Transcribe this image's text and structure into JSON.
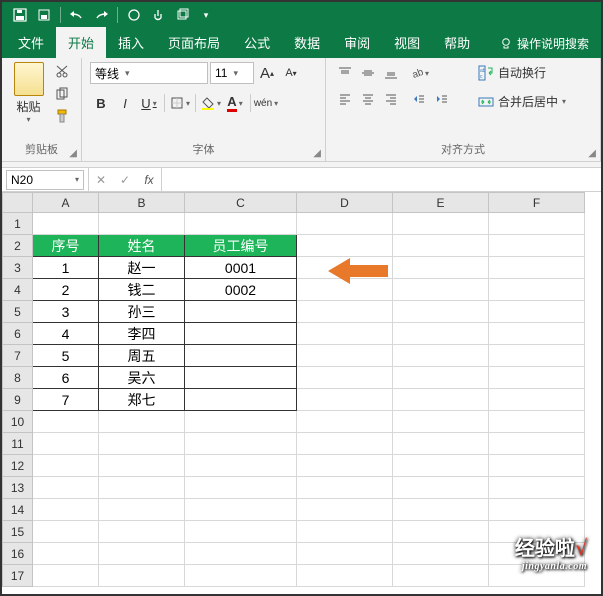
{
  "qat": {
    "dropdown": "▾"
  },
  "tabs": {
    "file": "文件",
    "home": "开始",
    "insert": "插入",
    "page_layout": "页面布局",
    "formulas": "公式",
    "data": "数据",
    "review": "审阅",
    "view": "视图",
    "help": "帮助",
    "tell_me": "操作说明搜索"
  },
  "ribbon": {
    "clipboard": {
      "paste": "粘贴",
      "label": "剪贴板"
    },
    "font": {
      "name": "等线",
      "size": "11",
      "bold": "B",
      "italic": "I",
      "underline": "U",
      "ruby": "wén",
      "label": "字体"
    },
    "align": {
      "wrap": "自动换行",
      "merge": "合并后居中",
      "label": "对齐方式"
    }
  },
  "namebox": "N20",
  "formula_value": "",
  "columns": [
    "A",
    "B",
    "C",
    "D",
    "E",
    "F"
  ],
  "rows": [
    1,
    2,
    3,
    4,
    5,
    6,
    7,
    8,
    9,
    10,
    11,
    12,
    13,
    14,
    15,
    16,
    17
  ],
  "table": {
    "headers": {
      "a": "序号",
      "b": "姓名",
      "c": "员工编号"
    },
    "data": [
      {
        "a": "1",
        "b": "赵一",
        "c": "0001"
      },
      {
        "a": "2",
        "b": "钱二",
        "c": "0002"
      },
      {
        "a": "3",
        "b": "孙三",
        "c": ""
      },
      {
        "a": "4",
        "b": "李四",
        "c": ""
      },
      {
        "a": "5",
        "b": "周五",
        "c": ""
      },
      {
        "a": "6",
        "b": "吴六",
        "c": ""
      },
      {
        "a": "7",
        "b": "郑七",
        "c": ""
      }
    ]
  },
  "watermark": {
    "text": "经验啦",
    "check": "√",
    "url": "jingyanla.com"
  }
}
